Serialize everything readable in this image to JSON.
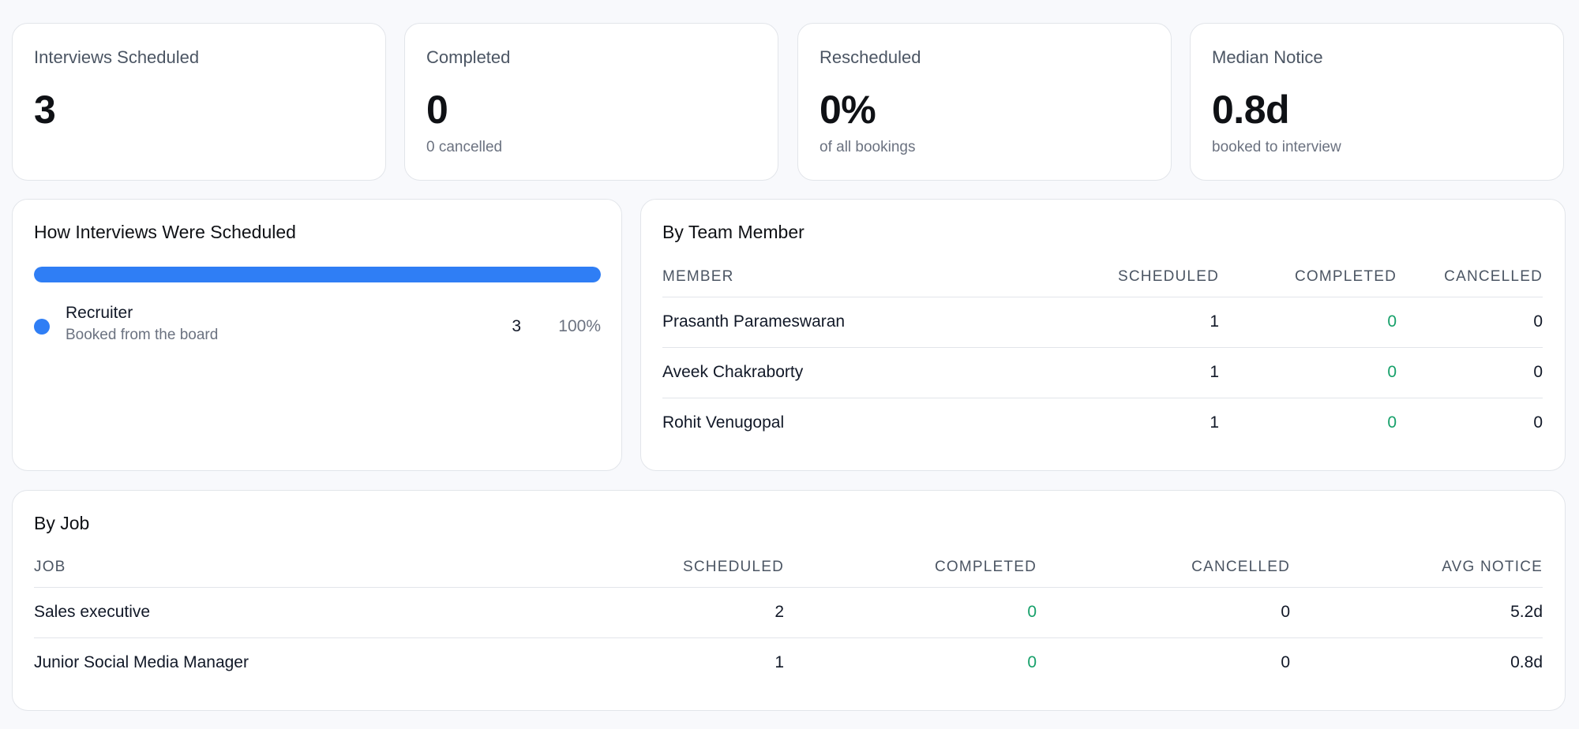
{
  "stats": [
    {
      "label": "Interviews Scheduled",
      "value": "3",
      "sub": ""
    },
    {
      "label": "Completed",
      "value": "0",
      "sub": "0 cancelled"
    },
    {
      "label": "Rescheduled",
      "value": "0%",
      "sub": "of all bookings"
    },
    {
      "label": "Median Notice",
      "value": "0.8d",
      "sub": "booked to interview"
    }
  ],
  "how_scheduled": {
    "title": "How Interviews Were Scheduled",
    "bar_fraction": 1.0,
    "bar_color": "#2f7ef5",
    "items": [
      {
        "name": "Recruiter",
        "description": "Booked from the board",
        "count": "3",
        "percent": "100%",
        "color": "#2f7ef5"
      }
    ]
  },
  "by_team_member": {
    "title": "By Team Member",
    "headers": [
      "MEMBER",
      "SCHEDULED",
      "COMPLETED",
      "CANCELLED"
    ],
    "rows": [
      {
        "member": "Prasanth Parameswaran",
        "scheduled": "1",
        "completed": "0",
        "cancelled": "0"
      },
      {
        "member": "Aveek Chakraborty",
        "scheduled": "1",
        "completed": "0",
        "cancelled": "0"
      },
      {
        "member": "Rohit Venugopal",
        "scheduled": "1",
        "completed": "0",
        "cancelled": "0"
      }
    ]
  },
  "by_job": {
    "title": "By Job",
    "headers": [
      "JOB",
      "SCHEDULED",
      "COMPLETED",
      "CANCELLED",
      "AVG NOTICE"
    ],
    "rows": [
      {
        "job": "Sales executive",
        "scheduled": "2",
        "completed": "0",
        "cancelled": "0",
        "avg_notice": "5.2d"
      },
      {
        "job": "Junior Social Media Manager",
        "scheduled": "1",
        "completed": "0",
        "cancelled": "0",
        "avg_notice": "0.8d"
      }
    ]
  },
  "colors": {
    "accent": "#2f7ef5",
    "completed_green": "#16a06a"
  }
}
